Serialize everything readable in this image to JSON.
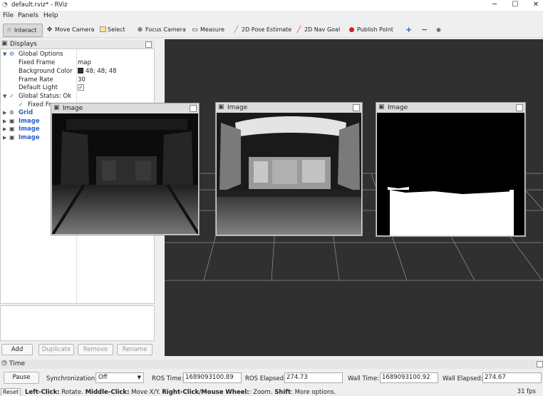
{
  "window": {
    "title": "default.rviz* - RViz",
    "controls": [
      "─",
      "☐",
      "✕"
    ]
  },
  "menu": [
    "File",
    "Panels",
    "Help"
  ],
  "toolbar": {
    "tools": [
      {
        "label": "Interact",
        "icon": "hand-icon"
      },
      {
        "label": "Move Camera",
        "icon": "move-camera-icon"
      },
      {
        "label": "Select",
        "icon": "select-icon"
      },
      {
        "label": "Focus Camera",
        "icon": "focus-camera-icon"
      },
      {
        "label": "Measure",
        "icon": "measure-icon"
      },
      {
        "label": "2D Pose Estimate",
        "icon": "pose-arrow-icon"
      },
      {
        "label": "2D Nav Goal",
        "icon": "nav-goal-arrow-icon"
      },
      {
        "label": "Publish Point",
        "icon": "map-pin-icon"
      }
    ],
    "active_tool": "Interact",
    "accent_green": "#3bbf3b",
    "accent_pink": "#d23aa0",
    "accent_red": "#cc2222",
    "accent_blue": "#2a62c9"
  },
  "displays_panel": {
    "title": "Displays",
    "global_options": {
      "label": "Global Options",
      "fixed_frame_label": "Fixed Frame",
      "fixed_frame_value": "map",
      "background_color_label": "Background Color",
      "background_color_value": "48; 48; 48",
      "background_color_hex": "#303030",
      "frame_rate_label": "Frame Rate",
      "frame_rate_value": "30",
      "default_light_label": "Default Light",
      "default_light_checked": true
    },
    "global_status": {
      "label": "Global Status: Ok",
      "fixed_frame_label": "Fixed Fr"
    },
    "displays": [
      "Grid",
      "Image",
      "Image",
      "Image"
    ],
    "buttons": {
      "add": "Add",
      "duplicate": "Duplicate",
      "remove": "Remove",
      "rename": "Rename"
    }
  },
  "image_panels": [
    {
      "title": "Image",
      "kind": "dark grayscale camera view"
    },
    {
      "title": "Image",
      "kind": "depth view"
    },
    {
      "title": "Image",
      "kind": "binary mask"
    }
  ],
  "time_panel": {
    "title": "Time",
    "pause_label": "Pause",
    "sync_label": "Synchronization:",
    "sync_value": "Off",
    "ros_time_label": "ROS Time:",
    "ros_time_value": "1689093100.89",
    "ros_elapsed_label": "ROS Elapsed:",
    "ros_elapsed_value": "274.73",
    "wall_time_label": "Wall Time:",
    "wall_time_value": "1689093100.92",
    "wall_elapsed_label": "Wall Elapsed:",
    "wall_elapsed_value": "274.67"
  },
  "status_bar": {
    "reset_label": "Reset",
    "hint_left_click": "Left-Click:",
    "hint_rotate": " Rotate. ",
    "hint_middle_click": "Middle-Click:",
    "hint_move": " Move X/Y. ",
    "hint_right_click": "Right-Click/Mouse Wheel:",
    "hint_zoom": ": Zoom. ",
    "hint_shift": "Shift",
    "hint_more": ": More options.",
    "fps": "31 fps"
  }
}
